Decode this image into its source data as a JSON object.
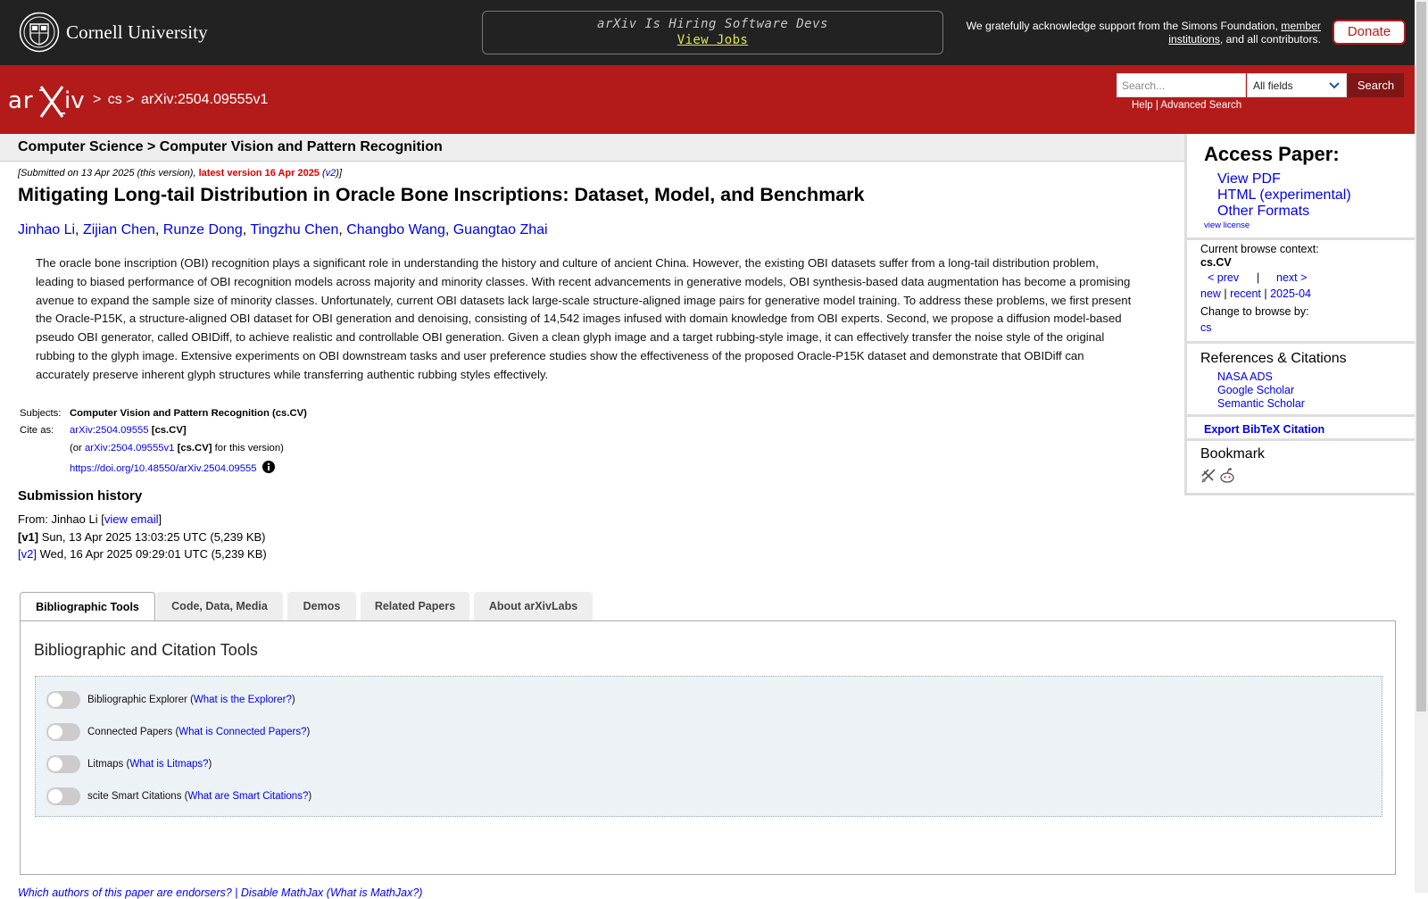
{
  "header": {
    "university": "Cornell University",
    "hiring_title": "arXiv Is Hiring Software Devs",
    "hiring_link": "View Jobs",
    "support_prefix": "We gratefully acknowledge support from the Simons Foundation, ",
    "support_link": "member institutions",
    "support_suffix": ", and all contributors.",
    "donate": "Donate"
  },
  "navbar": {
    "logo_text": "arXiv",
    "breadcrumb_sep": ">",
    "breadcrumb_cs": "cs",
    "breadcrumb_id": "arXiv:2504.09555v1",
    "search_placeholder": "Search...",
    "search_field": "All fields",
    "search_button": "Search",
    "help": "Help",
    "link_sep": "|",
    "advanced_search": "Advanced Search"
  },
  "subheader": "Computer Science > Computer Vision and Pattern Recognition",
  "paper": {
    "submitted_prefix": "[Submitted on 13 Apr 2025 (this version), ",
    "latest": "latest version 16 Apr 2025",
    "v2": "v2",
    "submitted_suffix": "]",
    "title": "Mitigating Long-tail Distribution in Oracle Bone Inscriptions: Dataset, Model, and Benchmark",
    "authors": [
      "Jinhao Li",
      "Zijian Chen",
      "Runze Dong",
      "Tingzhu Chen",
      "Changbo Wang",
      "Guangtao Zhai"
    ],
    "abstract": "The oracle bone inscription (OBI) recognition plays a significant role in understanding the history and culture of ancient China. However, the existing OBI datasets suffer from a long-tail distribution problem, leading to biased performance of OBI recognition models across majority and minority classes. With recent advancements in generative models, OBI synthesis-based data augmentation has become a promising avenue to expand the sample size of minority classes. Unfortunately, current OBI datasets lack large-scale structure-aligned image pairs for generative model training. To address these problems, we first present the Oracle-P15K, a structure-aligned OBI dataset for OBI generation and denoising, consisting of 14,542 images infused with domain knowledge from OBI experts. Second, we propose a diffusion model-based pseudo OBI generator, called OBIDiff, to achieve realistic and controllable OBI generation. Given a clean glyph image and a target rubbing-style image, it can effectively transfer the noise style of the original rubbing to the glyph image. Extensive experiments on OBI downstream tasks and user preference studies show the effectiveness of the proposed Oracle-P15K dataset and demonstrate that OBIDiff can accurately preserve inherent glyph structures while transferring authentic rubbing styles effectively.",
    "subjects_label": "Subjects:",
    "subjects": "Computer Vision and Pattern Recognition (cs.CV)",
    "cite_label": "Cite as:",
    "cite_id": "arXiv:2504.09555",
    "cite_cat": "[cs.CV]",
    "cite2_prefix": "(or ",
    "cite2_id": "arXiv:2504.09555v1",
    "cite2_cat": "[cs.CV]",
    "cite2_suffix": " for this version)",
    "doi": "https://doi.org/10.48550/arXiv.2504.09555"
  },
  "history": {
    "title": "Submission history",
    "from_prefix": "From: Jinhao Li [",
    "view_email": "view email",
    "from_suffix": "]",
    "v1_label": "[v1]",
    "v1_text": " Sun, 13 Apr 2025 13:03:25 UTC (5,239 KB)",
    "v2_label": "[v2]",
    "v2_text": " Wed, 16 Apr 2025 09:29:01 UTC (5,239 KB)"
  },
  "tabs": [
    "Bibliographic Tools",
    "Code, Data, Media",
    "Demos",
    "Related Papers",
    "About arXivLabs"
  ],
  "panel": {
    "title": "Bibliographic and Citation Tools",
    "tools": [
      {
        "name": "Bibliographic Explorer",
        "link": "What is the Explorer?"
      },
      {
        "name": "Connected Papers",
        "link": "What is Connected Papers?"
      },
      {
        "name": "Litmaps",
        "link": "What is Litmaps?"
      },
      {
        "name": "scite Smart Citations",
        "link": "What are Smart Citations?"
      }
    ]
  },
  "footer_links": "Which authors of this paper are endorsers? | Disable MathJax (What is MathJax?)",
  "sidebar": {
    "access_title": "Access Paper:",
    "view_pdf": "View PDF",
    "html": "HTML (experimental)",
    "other_formats": "Other Formats",
    "view_license": "view license",
    "browse_context_label": "Current browse context:",
    "browse_context": "cs.CV",
    "prev": "< prev",
    "sep": "|",
    "next": "next >",
    "new": "new",
    "recent": "recent",
    "month": "2025-04",
    "change_browse": "Change to browse by:",
    "cs": "cs",
    "refs_title": "References & Citations",
    "nasa": "NASA ADS",
    "google": "Google Scholar",
    "semantic": "Semantic Scholar",
    "bibtex": "Export BibTeX Citation",
    "bookmark": "Bookmark"
  },
  "colors": {
    "header_bg": "#222222",
    "arxiv_red": "#b31b1b",
    "link_blue": "#0000ee"
  }
}
